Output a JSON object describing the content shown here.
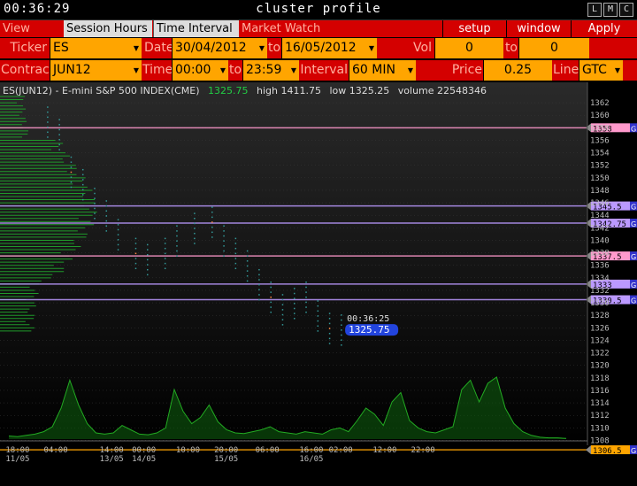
{
  "title": {
    "clock": "00:36:29",
    "text": "cluster profile",
    "buttons": [
      "L",
      "M",
      "C"
    ]
  },
  "menu": {
    "items": [
      "View DOM",
      "Session Hours",
      "Time Interval",
      "Market Watch"
    ],
    "selected": [
      "Session Hours",
      "Time Interval"
    ],
    "right": [
      "setup",
      "window",
      "Apply"
    ]
  },
  "controls": {
    "ticker_label": "Ticker",
    "ticker": "ES",
    "date_label": "Date",
    "date_from": "30/04/2012",
    "to_label": "to",
    "date_to": "16/05/2012",
    "vol_label": "Vol range",
    "vol_from": "0",
    "vol_to_label": "to",
    "vol_to": "0",
    "contract_label": "Contract",
    "contract": "JUN12",
    "time_label": "Time",
    "time_from": "00:00",
    "time_to_label": "to",
    "time_to": "23:59",
    "interval_label": "Interval",
    "interval": "60 MIN",
    "scale_label": "Price Scale",
    "scale": "0.25",
    "line_label": "Line",
    "line": "GTC"
  },
  "chart_info": {
    "symbol": "ES(JUN12) - E-mini S&P 500 INDEX(CME)",
    "last": "1325.75",
    "high": "high 1411.75",
    "low": "low 1325.25",
    "volume": "volume 22548346"
  },
  "chart_data": {
    "type": "line",
    "y_ticks": [
      1362,
      1360,
      1358,
      1356,
      1354,
      1352,
      1350,
      1348,
      1346,
      1344,
      1342,
      1340,
      1338,
      1336,
      1334,
      1332,
      1330,
      1328,
      1326,
      1324,
      1322,
      1320,
      1318,
      1316,
      1314,
      1312,
      1310,
      1308
    ],
    "ylim": [
      1307.5,
      1363
    ],
    "x_ticks": [
      {
        "t": "18:00",
        "d": "11/05",
        "pos": 0.03
      },
      {
        "t": "04:00",
        "d": "",
        "pos": 0.095
      },
      {
        "t": "14:00",
        "d": "13/05",
        "pos": 0.19
      },
      {
        "t": "00:00",
        "d": "14/05",
        "pos": 0.245
      },
      {
        "t": "10:00",
        "d": "",
        "pos": 0.32
      },
      {
        "t": "20:00",
        "d": "15/05",
        "pos": 0.385
      },
      {
        "t": "06:00",
        "d": "",
        "pos": 0.455
      },
      {
        "t": "16:00",
        "d": "16/05",
        "pos": 0.53
      },
      {
        "t": "02:00",
        "d": "",
        "pos": 0.58
      },
      {
        "t": "12:00",
        "d": "",
        "pos": 0.655
      },
      {
        "t": "22:00",
        "d": "",
        "pos": 0.72
      }
    ],
    "levels": [
      {
        "price": 1358,
        "label": "1358",
        "color": "#ff99cc"
      },
      {
        "price": 1345.5,
        "label": "1345.5",
        "color": "#bb99ff"
      },
      {
        "price": 1342.75,
        "label": "1342.75",
        "color": "#bb99ff"
      },
      {
        "price": 1337.5,
        "label": "1337.5",
        "color": "#ff99cc"
      },
      {
        "price": 1333,
        "label": "1333",
        "color": "#bb99ff"
      },
      {
        "price": 1330.5,
        "label": "1330.5",
        "color": "#bb99ff"
      },
      {
        "price": 1306.5,
        "label": "1306.5",
        "color": "#ffa500"
      }
    ],
    "level_tag": "G",
    "cursor": {
      "time": "00:36:25",
      "price": "1325.75",
      "value": 1325.75
    },
    "price_path": [
      [
        0.08,
        1359
      ],
      [
        0.1,
        1357
      ],
      [
        0.12,
        1351
      ],
      [
        0.14,
        1349
      ],
      [
        0.16,
        1346
      ],
      [
        0.18,
        1344
      ],
      [
        0.2,
        1341
      ],
      [
        0.23,
        1338
      ],
      [
        0.25,
        1337
      ],
      [
        0.28,
        1338
      ],
      [
        0.3,
        1340
      ],
      [
        0.33,
        1342
      ],
      [
        0.36,
        1343
      ],
      [
        0.38,
        1340
      ],
      [
        0.4,
        1338
      ],
      [
        0.42,
        1336
      ],
      [
        0.44,
        1333
      ],
      [
        0.46,
        1331
      ],
      [
        0.48,
        1329
      ],
      [
        0.5,
        1330
      ],
      [
        0.52,
        1331
      ],
      [
        0.54,
        1328
      ],
      [
        0.56,
        1326
      ],
      [
        0.58,
        1325.75
      ]
    ],
    "volume_series": [
      0.05,
      0.04,
      0.06,
      0.08,
      0.12,
      0.2,
      0.5,
      0.95,
      0.55,
      0.25,
      0.1,
      0.08,
      0.1,
      0.22,
      0.15,
      0.08,
      0.07,
      0.1,
      0.18,
      0.8,
      0.45,
      0.25,
      0.35,
      0.55,
      0.28,
      0.15,
      0.1,
      0.09,
      0.12,
      0.15,
      0.2,
      0.12,
      0.1,
      0.08,
      0.12,
      0.1,
      0.08,
      0.15,
      0.18,
      0.12,
      0.3,
      0.5,
      0.4,
      0.22,
      0.6,
      0.75,
      0.3,
      0.18,
      0.12,
      0.1,
      0.15,
      0.2,
      0.8,
      0.95,
      0.6,
      0.9,
      1.0,
      0.5,
      0.25,
      0.12,
      0.06,
      0.03,
      0.02,
      0.02,
      0.01
    ],
    "colors": {
      "volume": "#22aa22",
      "profile": "#1f9a2a",
      "grid_h": "#3a3a3a",
      "axis": "#bbbbbb"
    }
  }
}
